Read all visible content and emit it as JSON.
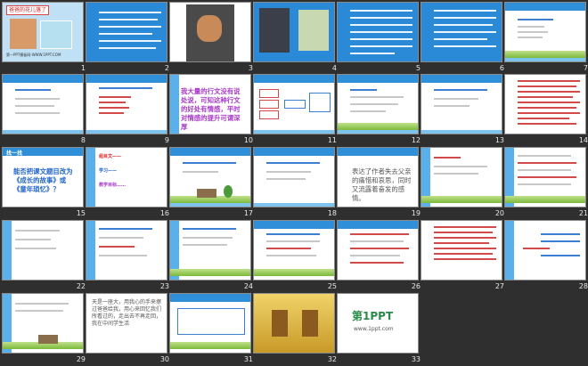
{
  "slides": [
    {
      "n": "1",
      "title": "爸爸的花儿落了",
      "caption": "第一PPT模板网-WWW.1PPT.COM"
    },
    {
      "n": "2"
    },
    {
      "n": "3"
    },
    {
      "n": "4"
    },
    {
      "n": "5"
    },
    {
      "n": "6"
    },
    {
      "n": "7"
    },
    {
      "n": "8"
    },
    {
      "n": "9"
    },
    {
      "n": "10",
      "text": "我大量的行文没有说处说，可知这种行文的好处有情感，平时对情感的提升可谓深厚"
    },
    {
      "n": "11"
    },
    {
      "n": "12"
    },
    {
      "n": "13"
    },
    {
      "n": "14"
    },
    {
      "n": "15",
      "tag": "找一找",
      "text": "能否把课文题目改为《成长的故事》或《童年琐忆》？"
    },
    {
      "n": "16",
      "t1": "组目文——",
      "t2": "学习——",
      "t3": "教学目标……"
    },
    {
      "n": "17"
    },
    {
      "n": "18"
    },
    {
      "n": "19",
      "text": "表达了作者失去父亲的痛惜和哀思，同时又流露着奋发的感情。"
    },
    {
      "n": "20"
    },
    {
      "n": "21"
    },
    {
      "n": "22"
    },
    {
      "n": "23"
    },
    {
      "n": "24"
    },
    {
      "n": "25"
    },
    {
      "n": "26"
    },
    {
      "n": "27"
    },
    {
      "n": "28"
    },
    {
      "n": "29"
    },
    {
      "n": "30",
      "text": "天是一座大，用我心的手来擦过爸爸给我，用心来回忆我们所看过的，走出去不再走回，我在中间学生活"
    },
    {
      "n": "31"
    },
    {
      "n": "32"
    },
    {
      "n": "33",
      "logo": "第1PPT",
      "site": "www.1ppt.com"
    }
  ]
}
